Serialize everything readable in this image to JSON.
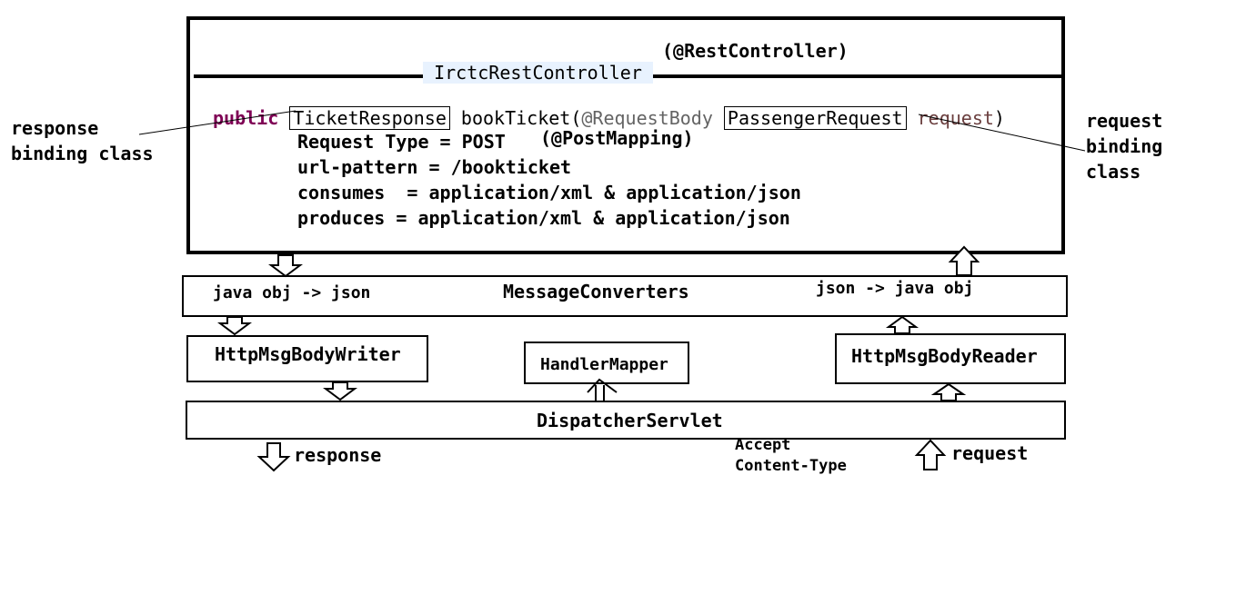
{
  "controller": {
    "class_name": "IrctcRestController",
    "annotation": "(@RestController)",
    "sig_public": "public",
    "sig_return": "TicketResponse",
    "sig_method": "bookTicket(",
    "sig_anno": "@RequestBody",
    "sig_param_type": "PassengerRequest",
    "sig_param_name": "request",
    "sig_close": ")",
    "request_type": "Request Type = POST",
    "post_mapping": "(@PostMapping)",
    "url_pattern": "url-pattern = /bookticket",
    "consumes": "consumes  = application/xml & application/json",
    "produces": "produces = application/xml & application/json"
  },
  "side_labels": {
    "left_line1": "response",
    "left_line2": "binding class",
    "right_line1": "request",
    "right_line2": "binding",
    "right_line3": "class"
  },
  "converters": {
    "left": "java obj -> json",
    "title": "MessageConverters",
    "right": "json -> java obj"
  },
  "writer": "HttpMsgBodyWriter",
  "mapper": "HandlerMapper",
  "reader": "HttpMsgBodyReader",
  "dispatcher": "DispatcherServlet",
  "bottom": {
    "response": "response",
    "accept": "Accept",
    "content_type": "Content-Type",
    "request": "request"
  }
}
